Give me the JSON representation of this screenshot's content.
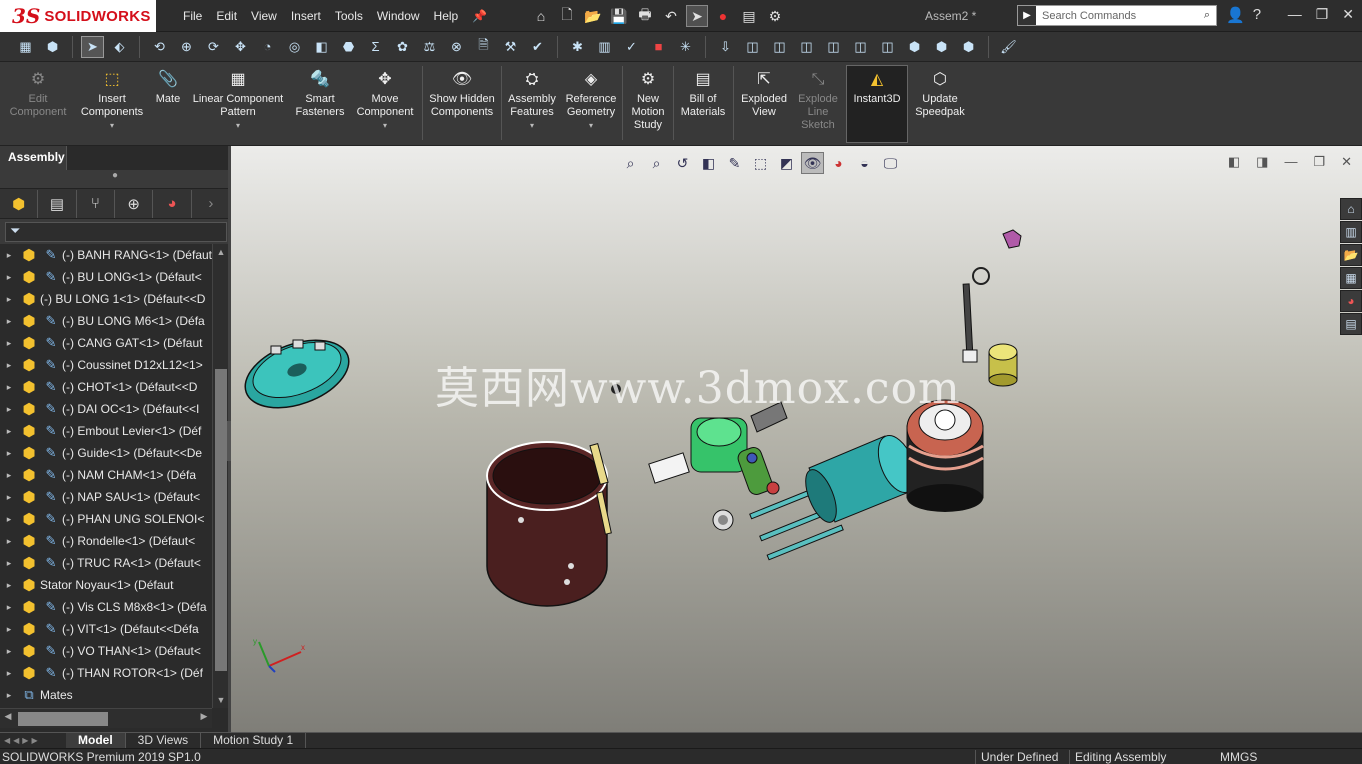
{
  "app": {
    "brand": "SOLIDWORKS",
    "brand_mark": "3S",
    "doc_title": "Assem2 *"
  },
  "menu": [
    "File",
    "Edit",
    "View",
    "Insert",
    "Tools",
    "Window",
    "Help"
  ],
  "search": {
    "placeholder": "Search Commands"
  },
  "commands": {
    "edit_component": "Edit Component",
    "insert_components": "Insert Components",
    "mate": "Mate",
    "linear_pattern": "Linear Component Pattern",
    "smart_fasteners": "Smart Fasteners",
    "move_component": "Move Component",
    "show_hidden": "Show Hidden Components",
    "assembly_features": "Assembly Features",
    "reference_geometry": "Reference Geometry",
    "new_motion_study": "New Motion Study",
    "bill_of_materials": "Bill of Materials",
    "exploded_view": "Exploded View",
    "explode_line_sketch": "Explode Line Sketch",
    "instant3d": "Instant3D",
    "update_speedpak": "Update Speedpak"
  },
  "feature_manager": {
    "tab": "Assembly",
    "items": [
      "(-) BANH RANG<1> (Défaut",
      "(-) BU LONG<1> (Défaut<",
      "(-) BU LONG 1<1> (Défaut<<D",
      "(-) BU LONG M6<1> (Défa",
      "(-) CANG GAT<1> (Défaut",
      "(-) Coussinet D12xL12<1>",
      "(-) CHOT<1> (Défaut<<D",
      "(-) DAI OC<1> (Défaut<<I",
      "(-) Embout Levier<1> (Déf",
      "(-) Guide<1> (Défaut<<De",
      "(-) NAM CHAM<1> (Défa",
      "(-) NAP SAU<1> (Défaut<",
      "(-) PHAN UNG SOLENOI<",
      "(-) Rondelle<1> (Défaut<",
      "(-) TRUC RA<1> (Défaut<",
      "Stator Noyau<1> (Défaut",
      "(-) Vis CLS M8x8<1> (Défa",
      "(-) VIT<1> (Défaut<<Défa",
      "(-) VO THAN<1> (Défaut<",
      "(-) THAN ROTOR<1> (Déf"
    ],
    "mates": "Mates"
  },
  "viewport": {
    "watermark": "莫西网www.3dmox.com"
  },
  "bottom_tabs": [
    "Model",
    "3D Views",
    "Motion Study 1"
  ],
  "status": {
    "product": "SOLIDWORKS Premium 2019 SP1.0",
    "state": "Under Defined",
    "mode": "Editing Assembly",
    "units": "MMGS"
  },
  "colors": {
    "brand_red": "#d40f1a",
    "part_yellow": "#f3c12f",
    "viewport_top": "#ececea",
    "viewport_bottom": "#7f7e78"
  }
}
